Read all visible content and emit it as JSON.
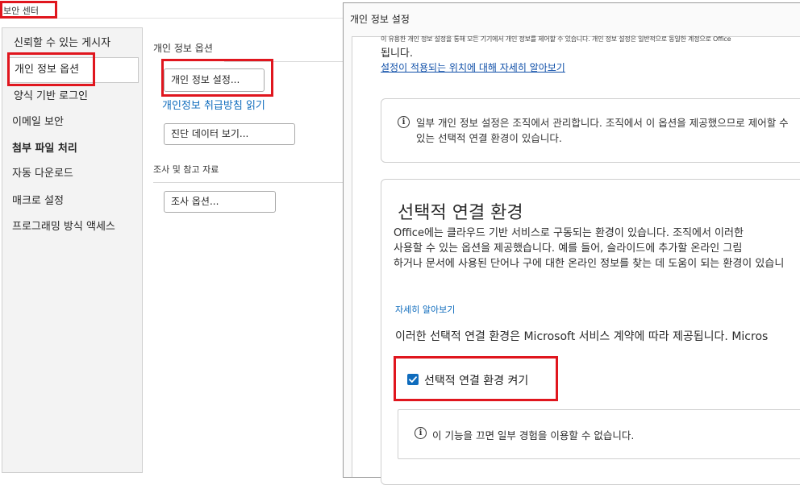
{
  "trust_center": {
    "title": "보안 센터",
    "nav": [
      {
        "label": "신뢰할 수 있는 게시자"
      },
      {
        "label": "개인 정보 옵션"
      },
      {
        "label": "양식 기반 로그인"
      },
      {
        "label": "이메일 보안"
      },
      {
        "label": "첨부 파일 처리"
      },
      {
        "label": "자동 다운로드"
      },
      {
        "label": "매크로 설정"
      },
      {
        "label": "프로그래밍 방식 액세스"
      }
    ],
    "privacy_section_title": "개인 정보 옵션",
    "privacy_settings_button": "개인 정보 설정...",
    "privacy_statement_link": "개인정보 취급방침 읽기",
    "diagnostic_button": "진단 데이터 보기...",
    "research_section_title": "조사 및 참고 자료",
    "research_button": "조사 옵션..."
  },
  "privacy_dialog": {
    "title": "개인 정보 설정",
    "description_line1": "이 유용한 개인 정보 설정을 통해 모든 기기에서 개인 정보를 제어할 수 있습니다. 개인 정보 설정은 일반적으로 동일한 계정으로 Office",
    "description_line2": "됩니다.",
    "applies_link": "설정이 적용되는 위치에 대해 자세히 알아보기",
    "managed_notice": "일부 개인 정보 설정은 조직에서 관리합니다. 조직에서 이 옵션을 제공했으므로 제어할 수\n있는 선택적 연결 환경이 있습니다.",
    "connected": {
      "title": "선택적 연결 환경",
      "description": "Office에는 클라우드 기반 서비스로 구동되는 환경이 있습니다. 조직에서 이러한\n사용할 수 있는 옵션을 제공했습니다. 예를 들어, 슬라이드에 추가할 온라인 그림\n하거나 문서에 사용된 단어나 구에 대한 온라인 정보를 찾는 데 도움이 되는 환경이 있습니",
      "learn_more": "자세히 알아보기",
      "service_note": "이러한 선택적 연결 환경은 Microsoft 서비스 계약에 따라 제공됩니다. Micros",
      "checkbox_label": "선택적 연결 환경 켜기",
      "checkbox_checked": true,
      "warning": "이 기능을 끄면 일부 경험을 이용할 수 없습니다."
    }
  },
  "colors": {
    "highlight": "#e0161e",
    "link": "#0f6cbd",
    "checkbox": "#0f6cbd"
  }
}
